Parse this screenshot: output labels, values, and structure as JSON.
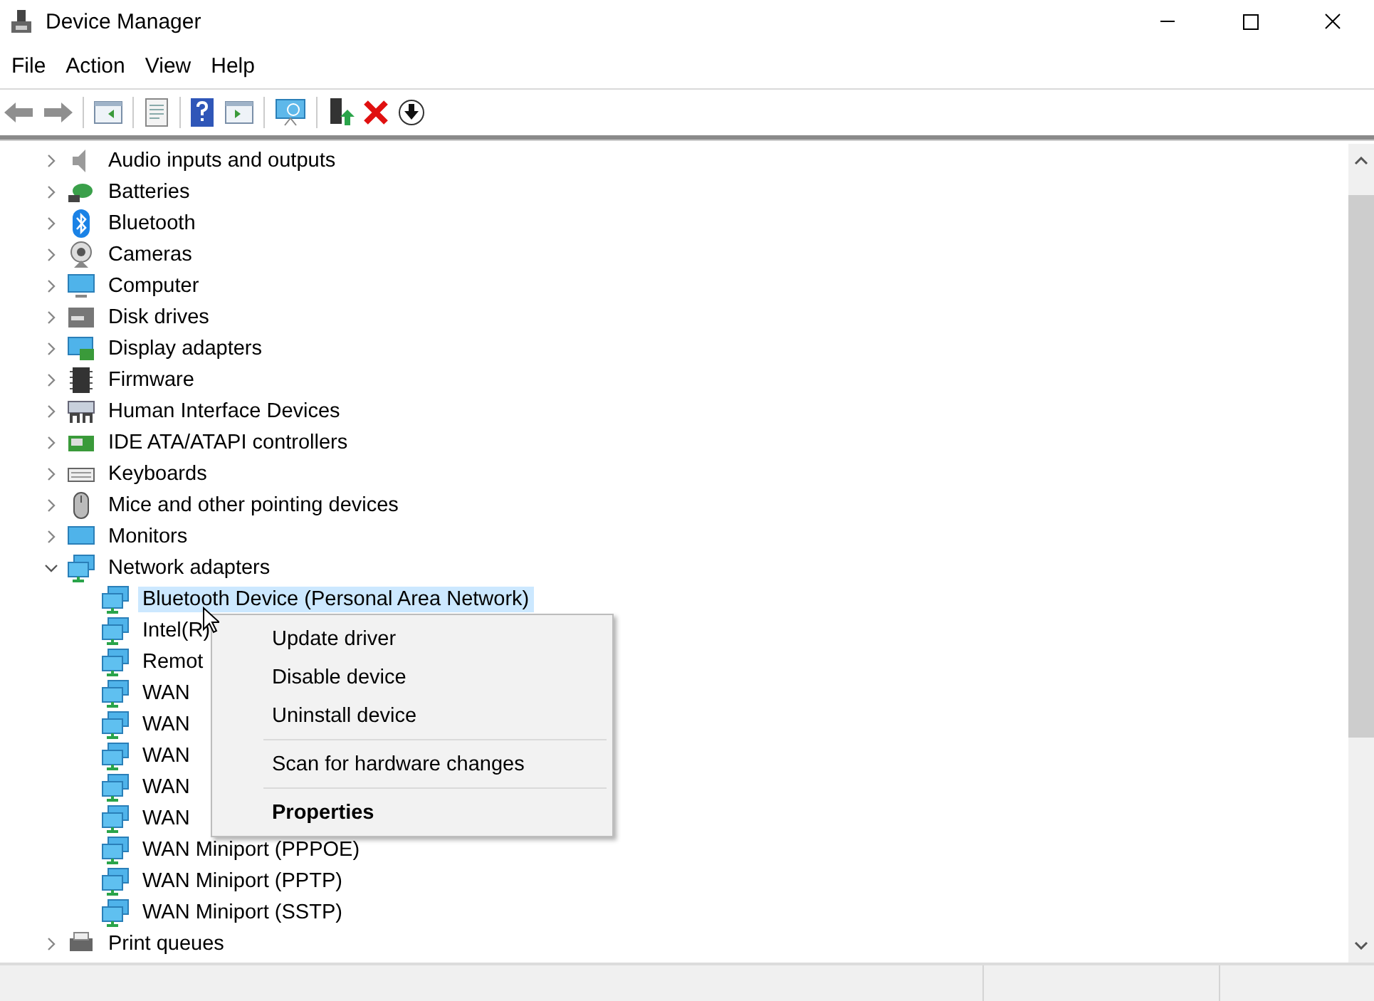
{
  "window": {
    "title": "Device Manager"
  },
  "menu_bar": [
    "File",
    "Action",
    "View",
    "Help"
  ],
  "tree": [
    {
      "label": "Audio inputs and outputs",
      "expanded": false,
      "selected": false
    },
    {
      "label": "Batteries",
      "expanded": false,
      "selected": false
    },
    {
      "label": "Bluetooth",
      "expanded": false,
      "selected": false
    },
    {
      "label": "Cameras",
      "expanded": false,
      "selected": false
    },
    {
      "label": "Computer",
      "expanded": false,
      "selected": false
    },
    {
      "label": "Disk drives",
      "expanded": false,
      "selected": false
    },
    {
      "label": "Display adapters",
      "expanded": false,
      "selected": false
    },
    {
      "label": "Firmware",
      "expanded": false,
      "selected": false
    },
    {
      "label": "Human Interface Devices",
      "expanded": false,
      "selected": false
    },
    {
      "label": "IDE ATA/ATAPI controllers",
      "expanded": false,
      "selected": false
    },
    {
      "label": "Keyboards",
      "expanded": false,
      "selected": false
    },
    {
      "label": "Mice and other pointing devices",
      "expanded": false,
      "selected": false
    },
    {
      "label": "Monitors",
      "expanded": false,
      "selected": false
    },
    {
      "label": "Network adapters",
      "expanded": true,
      "selected": false,
      "children": [
        {
          "label": "Bluetooth Device (Personal Area Network)",
          "selected": true
        },
        {
          "label": "Intel(R)",
          "selected": false
        },
        {
          "label": "Remot",
          "selected": false
        },
        {
          "label": "WAN",
          "selected": false
        },
        {
          "label": "WAN",
          "selected": false
        },
        {
          "label": "WAN",
          "selected": false
        },
        {
          "label": "WAN",
          "selected": false
        },
        {
          "label": "WAN",
          "selected": false
        },
        {
          "label": "WAN Miniport (PPPOE)",
          "selected": false
        },
        {
          "label": "WAN Miniport (PPTP)",
          "selected": false
        },
        {
          "label": "WAN Miniport (SSTP)",
          "selected": false
        }
      ]
    },
    {
      "label": "Print queues",
      "expanded": false,
      "selected": false
    }
  ],
  "context_menu": [
    {
      "kind": "item",
      "label": "Update driver",
      "default": false
    },
    {
      "kind": "item",
      "label": "Disable device",
      "default": false
    },
    {
      "kind": "item",
      "label": "Uninstall device",
      "default": false
    },
    {
      "kind": "separator"
    },
    {
      "kind": "item",
      "label": "Scan for hardware changes",
      "default": false
    },
    {
      "kind": "separator"
    },
    {
      "kind": "item",
      "label": "Properties",
      "default": true
    }
  ]
}
